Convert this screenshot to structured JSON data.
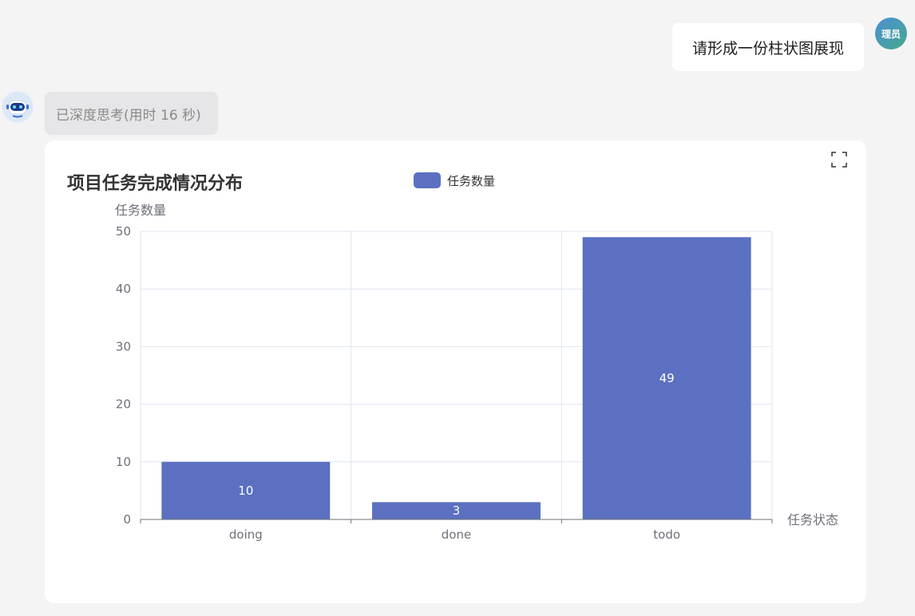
{
  "user": {
    "avatar_text": "理员",
    "message": "请形成一份柱状图展现"
  },
  "bot": {
    "avatar_icon": "robot-icon",
    "thinking_label": "已深度思考(用时 16 秒)"
  },
  "chart_toolbar": {
    "fullscreen_icon": "fullscreen-icon"
  },
  "colors": {
    "bar": "#5b70c0",
    "grid": "#e0e6f1",
    "axis": "#6e7079"
  },
  "chart_data": {
    "type": "bar",
    "title": "项目任务完成情况分布",
    "legend_position": "top-center",
    "categories": [
      "doing",
      "done",
      "todo"
    ],
    "series": [
      {
        "name": "任务数量",
        "values": [
          10,
          3,
          49
        ]
      }
    ],
    "xlabel": "任务状态",
    "ylabel": "任务数量",
    "ylim": [
      0,
      50
    ],
    "yticks": [
      0,
      10,
      20,
      30,
      40,
      50
    ],
    "grid": true,
    "data_labels": true
  }
}
